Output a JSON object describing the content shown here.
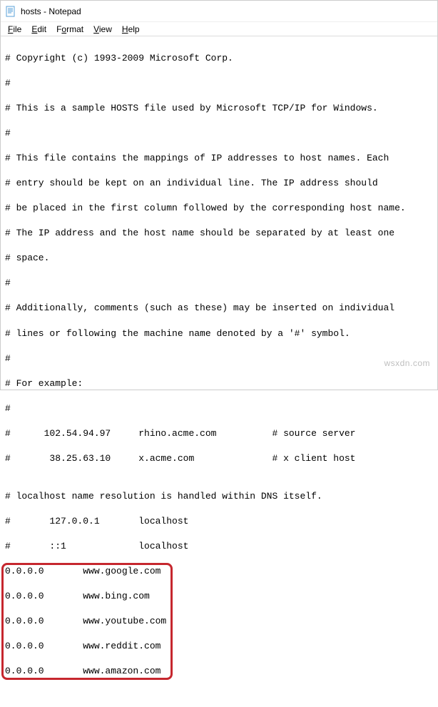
{
  "titlebar": {
    "title": "hosts - Notepad"
  },
  "menubar": {
    "file": "File",
    "edit": "Edit",
    "format": "Format",
    "view": "View",
    "help": "Help"
  },
  "content": {
    "l1": "# Copyright (c) 1993-2009 Microsoft Corp.",
    "l2": "#",
    "l3": "# This is a sample HOSTS file used by Microsoft TCP/IP for Windows.",
    "l4": "#",
    "l5": "# This file contains the mappings of IP addresses to host names. Each",
    "l6": "# entry should be kept on an individual line. The IP address should",
    "l7": "# be placed in the first column followed by the corresponding host name.",
    "l8": "# The IP address and the host name should be separated by at least one",
    "l9": "# space.",
    "l10": "#",
    "l11": "# Additionally, comments (such as these) may be inserted on individual",
    "l12": "# lines or following the machine name denoted by a '#' symbol.",
    "l13": "#",
    "l14": "# For example:",
    "l15": "#",
    "l16": "#      102.54.94.97     rhino.acme.com          # source server",
    "l17": "#       38.25.63.10     x.acme.com              # x client host",
    "l18": "",
    "l19": "# localhost name resolution is handled within DNS itself.",
    "l20": "#       127.0.0.1       localhost",
    "l21": "#       ::1             localhost",
    "l22": "0.0.0.0       www.google.com",
    "l23": "0.0.0.0       www.bing.com",
    "l24": "0.0.0.0       www.youtube.com",
    "l25": "0.0.0.0       www.reddit.com",
    "l26": "0.0.0.0       www.amazon.com"
  },
  "watermark": "wsxdn.com"
}
